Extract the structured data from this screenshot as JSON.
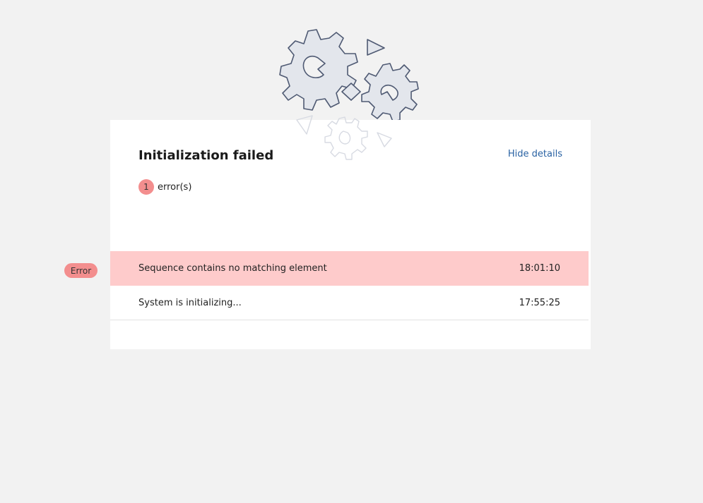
{
  "dialog": {
    "title": "Initialization failed",
    "hide_details_label": "Hide details",
    "error_count": "1",
    "error_suffix": "error(s)"
  },
  "log": [
    {
      "level": "Error",
      "message": "Sequence contains no matching element",
      "time": "18:01:10"
    },
    {
      "level": "",
      "message": "System is initializing...",
      "time": "17:55:25"
    }
  ],
  "illustration": {
    "icon": "gears-icon"
  },
  "colors": {
    "background": "#f2f2f2",
    "card": "#ffffff",
    "error_row": "#fecbcb",
    "error_badge": "#f38e8e",
    "link": "#2962a3",
    "gear_fill": "#e3e6ec",
    "gear_stroke": "#4f5a73"
  }
}
